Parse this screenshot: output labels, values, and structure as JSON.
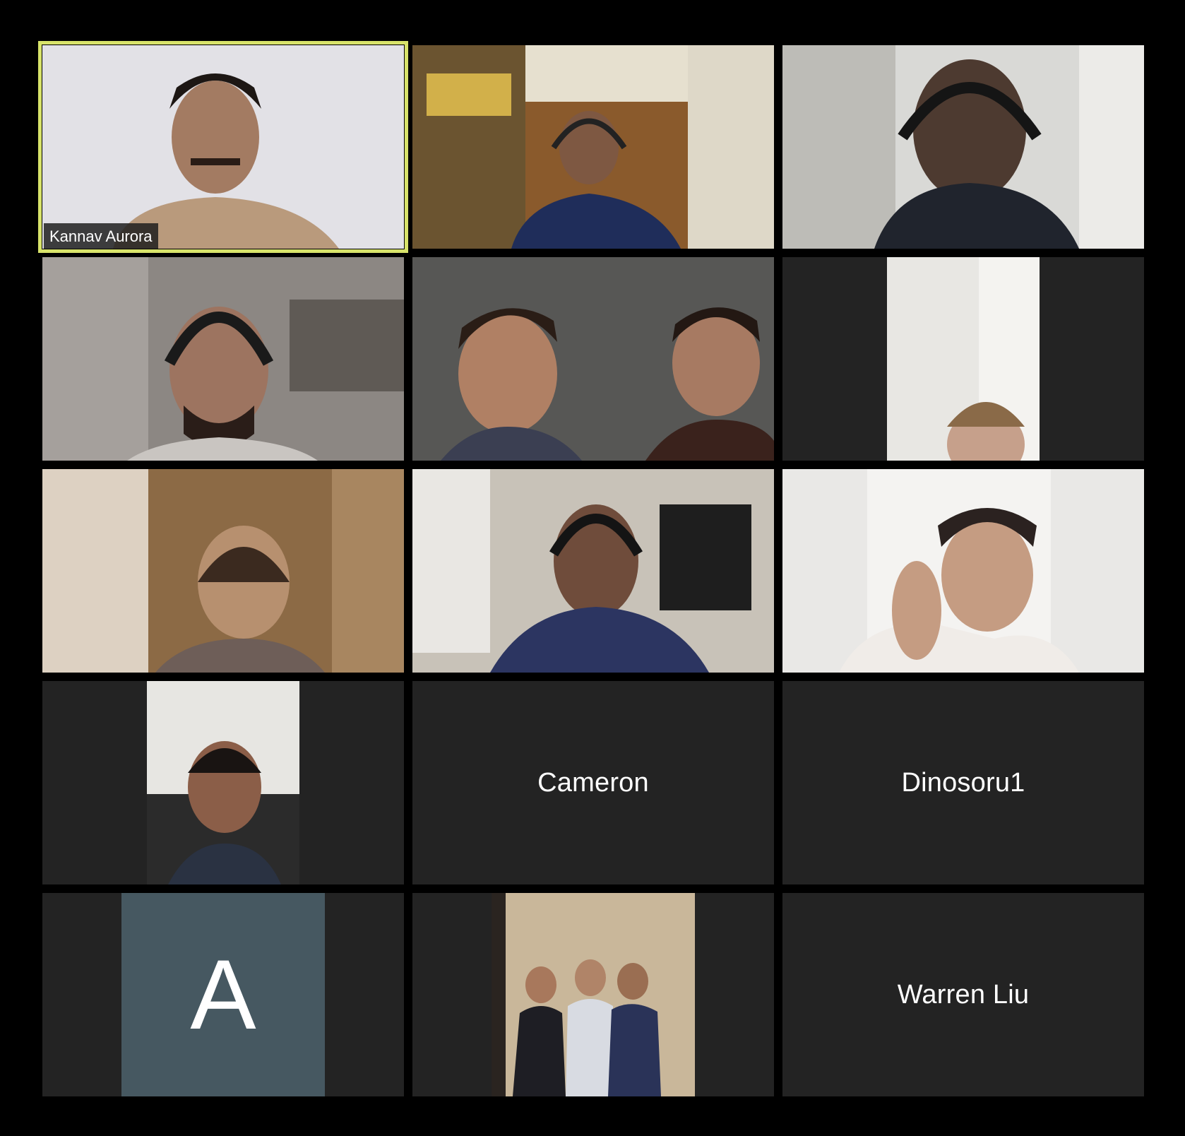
{
  "meeting": {
    "view": "gallery",
    "accent_active_border": "#d8e36a",
    "tile_background": "#232323",
    "participants": [
      {
        "name": "Kannav Aurora",
        "show_name": true,
        "video": "on",
        "active_speaker": true
      },
      {
        "name": "",
        "video": "on"
      },
      {
        "name": "",
        "video": "on"
      },
      {
        "name": "",
        "video": "on"
      },
      {
        "name": "",
        "video": "on"
      },
      {
        "name": "",
        "video": "on",
        "aspect": "portrait"
      },
      {
        "name": "",
        "video": "on"
      },
      {
        "name": "",
        "video": "on"
      },
      {
        "name": "",
        "video": "on"
      },
      {
        "name": "",
        "video": "on",
        "aspect": "portrait"
      },
      {
        "name": "Cameron",
        "video": "off"
      },
      {
        "name": "Dinosoru1",
        "video": "off"
      },
      {
        "name": "",
        "video": "off",
        "avatar_letter": "A",
        "avatar_color": "#465861"
      },
      {
        "name": "",
        "video": "profile-photo"
      },
      {
        "name": "Warren Liu",
        "video": "off"
      }
    ]
  }
}
